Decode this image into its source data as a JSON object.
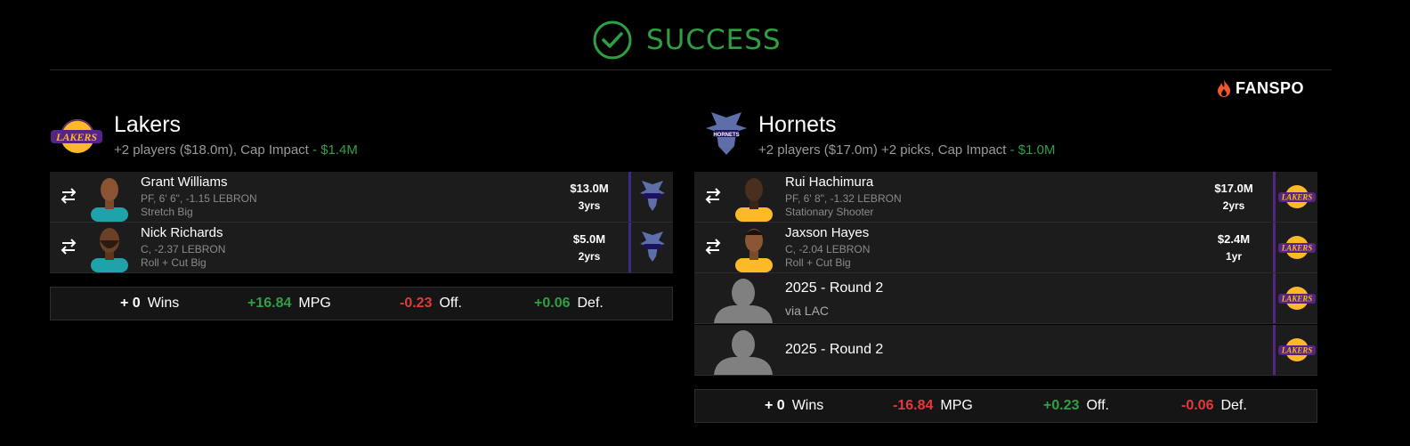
{
  "header": {
    "status": "SUCCESS",
    "brand": "FANSPO"
  },
  "colors": {
    "success": "#2ea043",
    "positive": "#2ea043",
    "negative": "#e5383b",
    "hornets_stripe": "#3b2a86",
    "lakers_stripe": "#552583"
  },
  "teams": [
    {
      "name": "Lakers",
      "logo_icon": "lakers-logo",
      "summary_prefix": "+2 players ($18.0m), Cap Impact",
      "cap_impact": "- $1.4M",
      "assets": [
        {
          "name": "Grant Williams",
          "details": "PF, 6' 6\", -1.15 LEBRON",
          "role": "Stretch Big",
          "salary": "$13.0M",
          "years": "3yrs",
          "dest_icon": "hornets-logo"
        },
        {
          "name": "Nick Richards",
          "details": "C, -2.37 LEBRON",
          "role": "Roll + Cut Big",
          "salary": "$5.0M",
          "years": "2yrs",
          "dest_icon": "hornets-logo"
        }
      ],
      "stats": [
        {
          "value": "+ 0",
          "label": "Wins",
          "tone": "neu"
        },
        {
          "value": "+16.84",
          "label": "MPG",
          "tone": "pos"
        },
        {
          "value": "-0.23",
          "label": "Off.",
          "tone": "neg"
        },
        {
          "value": "+0.06",
          "label": "Def.",
          "tone": "pos"
        }
      ]
    },
    {
      "name": "Hornets",
      "logo_icon": "hornets-logo",
      "summary_prefix": "+2 players ($17.0m) +2 picks, Cap Impact",
      "cap_impact": "- $1.0M",
      "assets": [
        {
          "name": "Rui Hachimura",
          "details": "PF, 6' 8\", -1.32 LEBRON",
          "role": "Stationary Shooter",
          "salary": "$17.0M",
          "years": "2yrs",
          "dest_icon": "lakers-logo"
        },
        {
          "name": "Jaxson Hayes",
          "details": "C, -2.04 LEBRON",
          "role": "Roll + Cut Big",
          "salary": "$2.4M",
          "years": "1yr",
          "dest_icon": "lakers-logo"
        },
        {
          "pick": "2025 - Round 2",
          "via": "via LAC",
          "dest_icon": "lakers-logo"
        },
        {
          "pick": "2025 - Round 2",
          "dest_icon": "lakers-logo"
        }
      ],
      "stats": [
        {
          "value": "+ 0",
          "label": "Wins",
          "tone": "neu"
        },
        {
          "value": "-16.84",
          "label": "MPG",
          "tone": "neg"
        },
        {
          "value": "+0.23",
          "label": "Off.",
          "tone": "pos"
        },
        {
          "value": "-0.06",
          "label": "Def.",
          "tone": "neg"
        }
      ]
    }
  ]
}
